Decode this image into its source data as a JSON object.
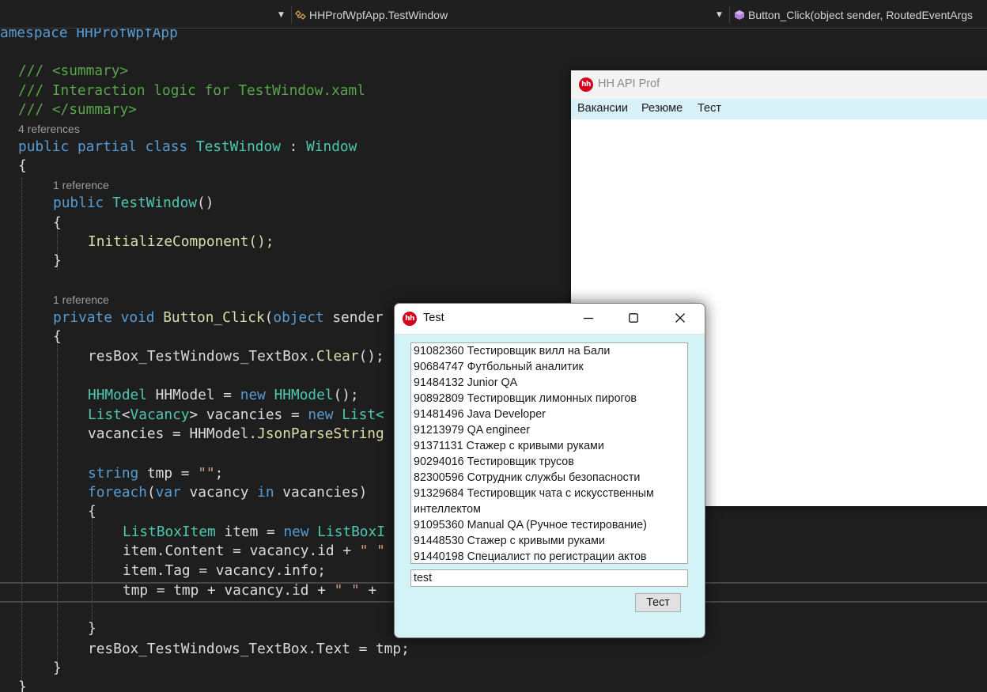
{
  "ide": {
    "nav_left_dropdown": "",
    "nav_class": "HHProfWpfApp.TestWindow",
    "nav_member": "Button_Click(object sender, RoutedEventArgs"
  },
  "code": {
    "l1": "amespace HHProfWpfApp",
    "summary_open": "/// <summary>",
    "summary_text": "/// Interaction logic for TestWindow.xaml",
    "summary_close": "/// </summary>",
    "refs_class": "4 references",
    "refs_ctor": "1 reference",
    "refs_click": "1 reference",
    "kw_public": "public",
    "kw_partial": "partial",
    "kw_class": "class",
    "type_testwindow": "TestWindow",
    "colon": ":",
    "type_window": "Window",
    "brace_open": "{",
    "brace_close": "}",
    "ctor_parens": "()",
    "init_call": "InitializeComponent();",
    "kw_private": "private",
    "kw_void": "void",
    "method_click": "Button_Click",
    "paren_open": "(",
    "kw_object": "object",
    "sender_trunc": "sender",
    "clear_obj": "resBox_TestWindows_TextBox.",
    "clear_method": "Clear",
    "clear_end": "();",
    "type_hhmodel": "HHModel",
    "var_hhmodel": "HHModel =",
    "kw_new": "new",
    "hhmodel_end": "();",
    "type_list": "List",
    "lt": "<",
    "type_vacancy": "Vacancy",
    "gt_vac": "> vacancies =",
    "list_trunc": "List<",
    "vac_assign": "vacancies = HHModel.",
    "json_parse": "JsonParseString",
    "kw_string": "string",
    "tmp_assign": "tmp = ",
    "empty_str": "\"\"",
    "semicolon": ";",
    "kw_foreach": "foreach",
    "kw_var": "var",
    "vacancy_word": "vacancy",
    "kw_in": "in",
    "vacancies_end": "vacancies)",
    "type_listboxitem": "ListBoxItem",
    "item_assign": "item =",
    "listbox_trunc": "ListBoxI",
    "content_line": "item.Content = vacancy.id + ",
    "space_str": "\" \"",
    "tag_line": "item.Tag = vacancy.info;",
    "tmp_line": "tmp = tmp + vacancy.id + ",
    "plus": " +",
    "text_line_a": "resBox_TestWindows_TextBox.Text = tmp;",
    "closing_ns": "}"
  },
  "main_window": {
    "title": "HH API Prof",
    "menu": [
      "Вакансии",
      "Резюме",
      "Тест"
    ]
  },
  "test_window": {
    "title": "Test",
    "logo_text": "hh",
    "minimize_glyph": "—",
    "maximize_glyph": "☐",
    "close_glyph": "✕",
    "list_items": [
      "91082360 Тестировщик вилл на Бали",
      "90684747 Футбольный аналитик",
      "91484132 Junior QA",
      "90892809 Тестировщик лимонных пирогов",
      "91481496 Java Developer",
      "91213979 QA engineer",
      "91371131 Стажер с кривыми руками",
      "90294016 Тестировщик трусов",
      "82300596 Сотрудник службы безопасности",
      "91329684 Тестировщик чата с искусственным интеллектом",
      "91095360 Manual QA (Ручное тестирование)",
      "91448530 Стажер с кривыми руками",
      "91440198 Специалист по регистрации актов"
    ],
    "textbox_value": "test",
    "button_label": "Тест"
  }
}
